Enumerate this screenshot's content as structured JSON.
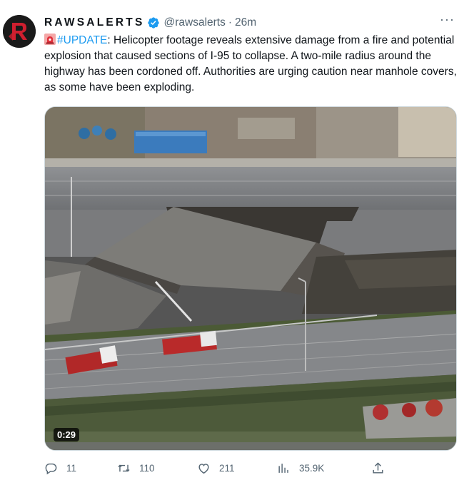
{
  "tweet": {
    "display_name": "RAWSALERTS",
    "handle": "@rawsalerts",
    "separator": "·",
    "time": "26m",
    "more": "···",
    "hashtag": "#UPDATE",
    "text_after_hashtag": ": Helicopter footage reveals extensive damage from a fire and potential explosion that caused sections of I-95 to collapse. A two-mile radius around the highway has been cordoned off. Authorities are urging caution near manhole covers, as some have been exploding."
  },
  "media": {
    "duration": "0:29"
  },
  "actions": {
    "replies": "11",
    "retweets": "110",
    "likes": "211",
    "views": "35.9K"
  },
  "colors": {
    "link": "#1d9bf0",
    "muted": "#536471",
    "verified": "#1d9bf0"
  },
  "icons": [
    "reply-icon",
    "retweet-icon",
    "like-icon",
    "views-icon",
    "share-icon",
    "verified-icon",
    "siren-icon"
  ]
}
